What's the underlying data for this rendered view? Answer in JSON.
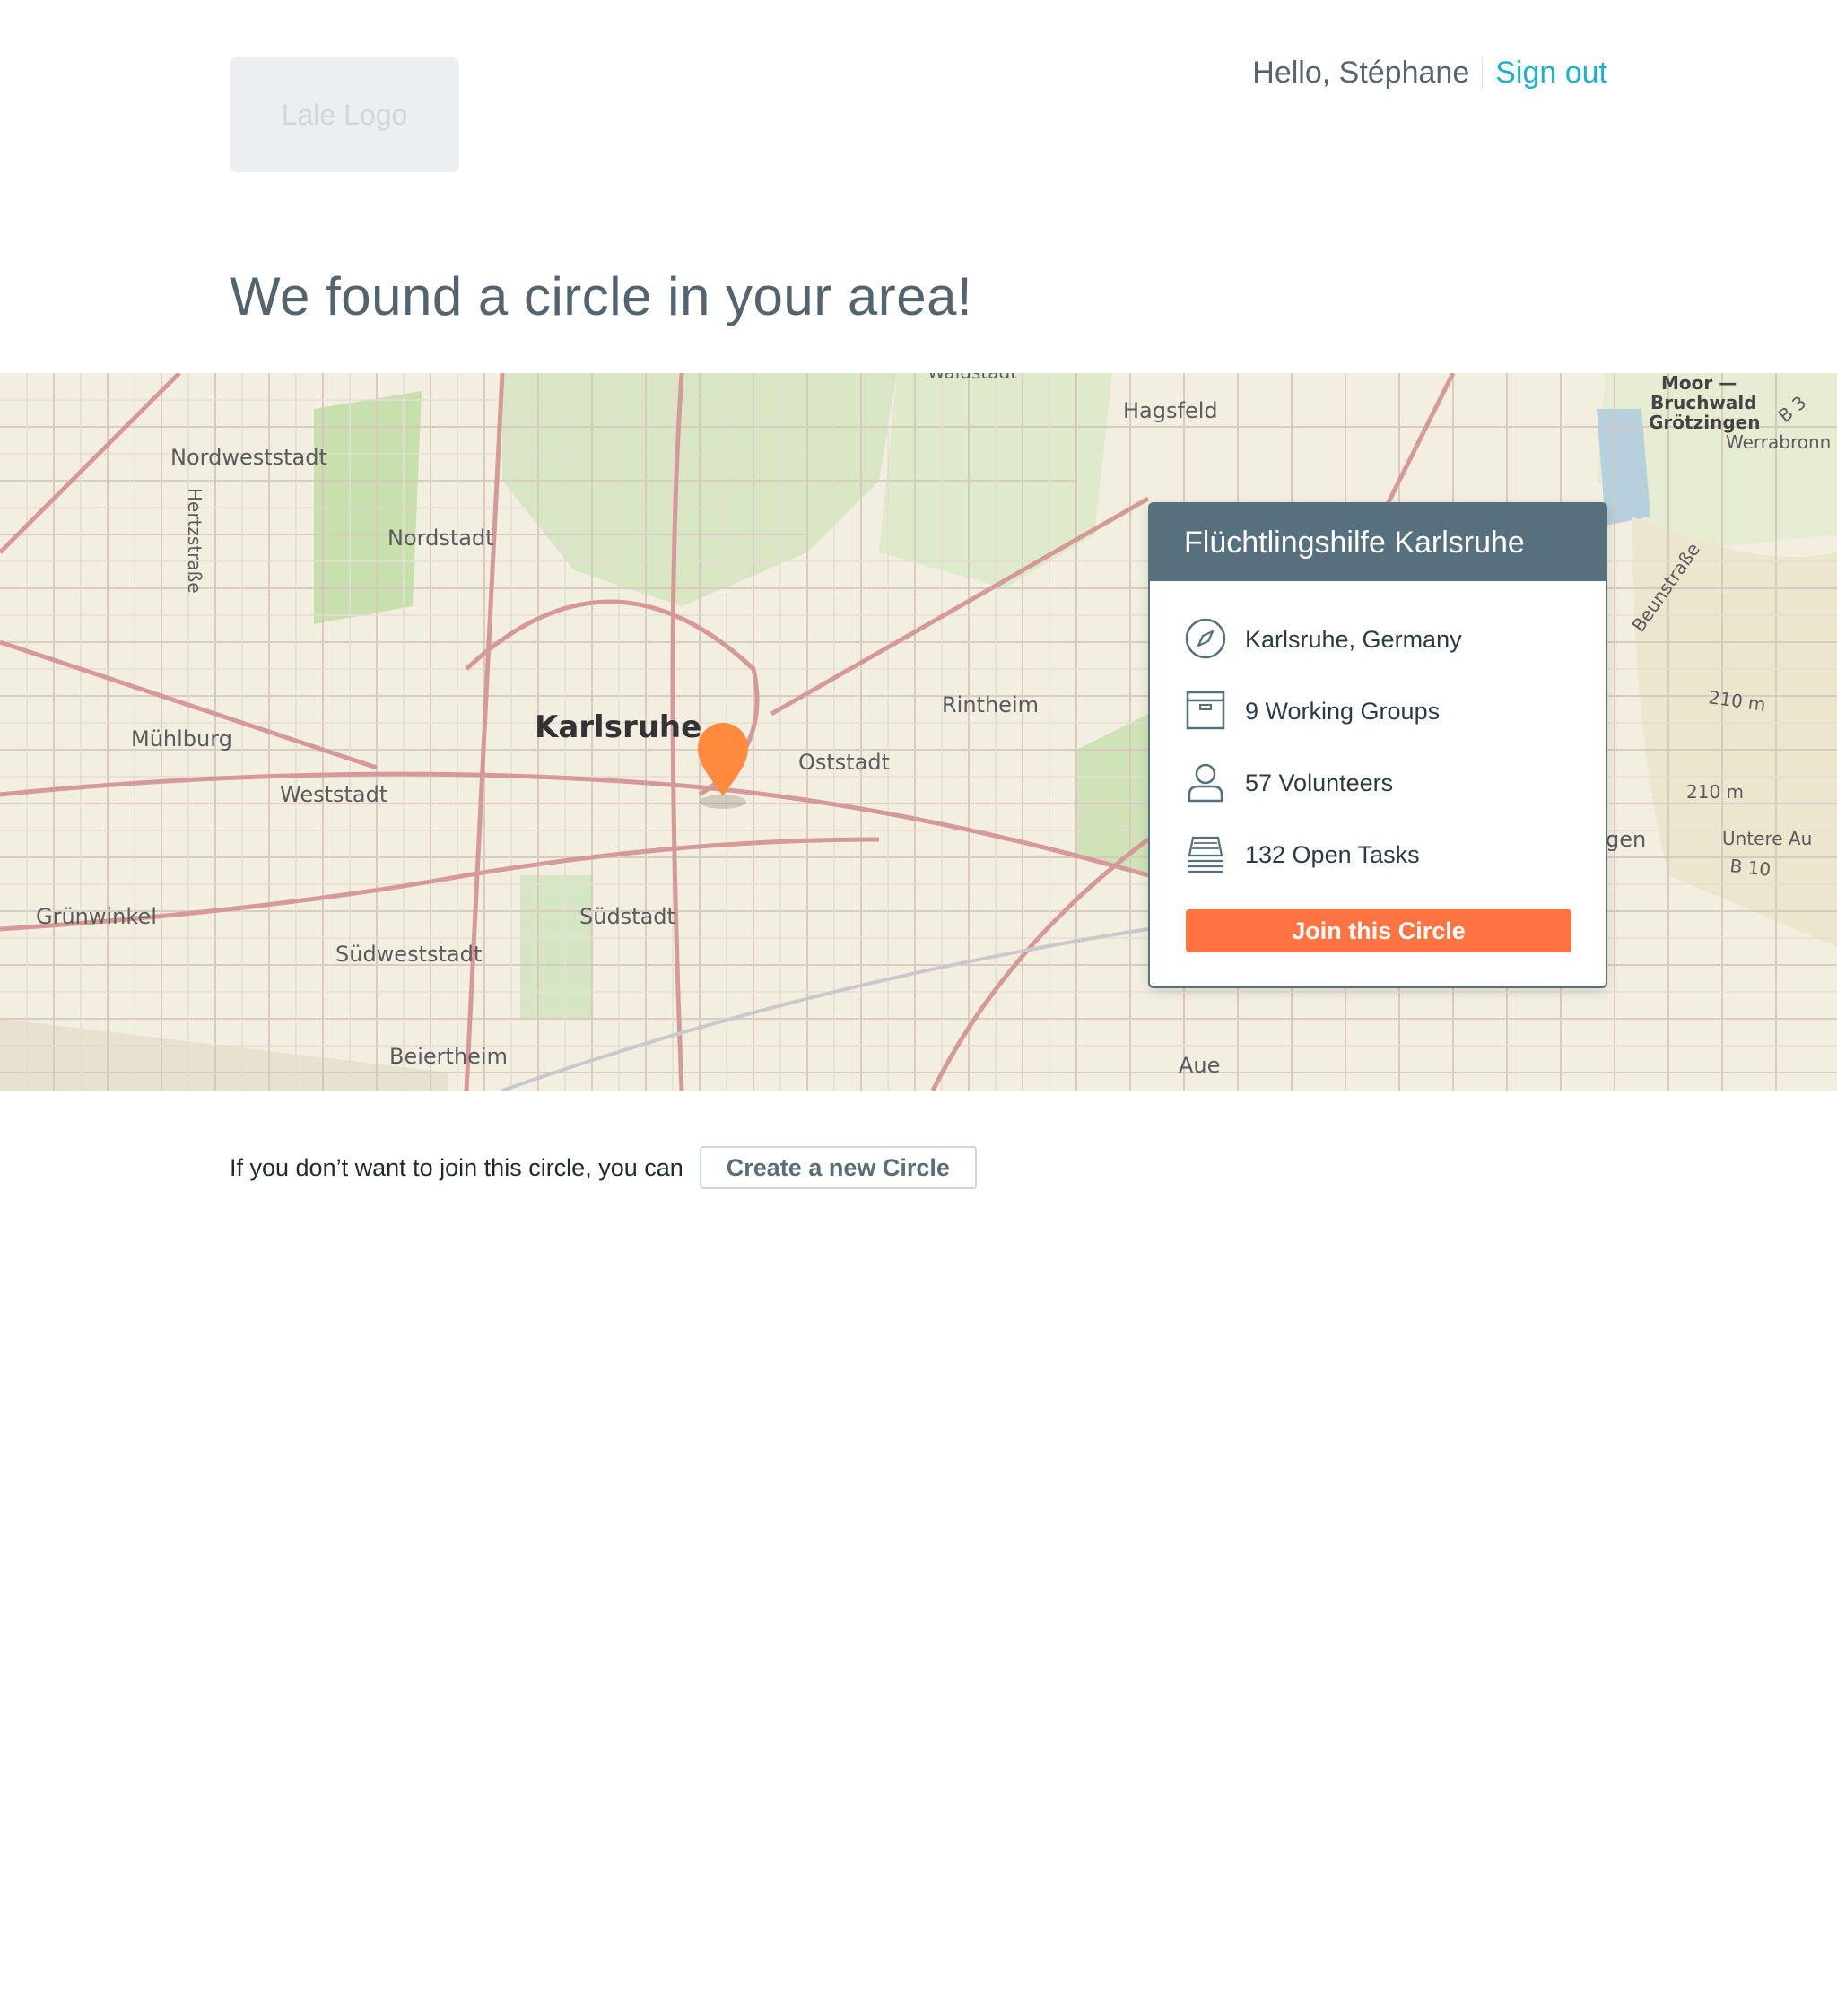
{
  "header": {
    "logo_text": "Lale Logo",
    "greeting": "Hello, Stéphane",
    "sign_out": "Sign out"
  },
  "headline": "We found a circle in your area!",
  "map": {
    "city_label": "Karlsruhe",
    "labels": {
      "nordweststadt": "Nordweststadt",
      "nordstadt": "Nordstadt",
      "hertzstrasse": "Hertzstraße",
      "muehlburg": "Mühlburg",
      "weststadt": "Weststadt",
      "gruenwinkel": "Grünwinkel",
      "suedweststadt": "Südweststadt",
      "beiertheim": "Beiertheim",
      "suedstadt": "Südstadt",
      "oststadt": "Oststadt",
      "rintheim": "Rintheim",
      "hagsfeld": "Hagsfeld",
      "aue": "Aue",
      "waldstadt": "Waldstadt",
      "moor": "Moor —",
      "bruchwald": "Bruchwald",
      "groetzingen": "Grötzingen",
      "werrabronn": "Werrabronn",
      "b3": "B 3",
      "beunstrasse": "Beunstraße",
      "elev1": "210 m",
      "elev2": "210 m",
      "untere_au": "Untere Au",
      "b10": "B 10",
      "gen": "gen"
    },
    "marker_icon": "map-pin-icon",
    "marker_color": "#ff8a3d"
  },
  "circle_card": {
    "title": "Flüchtlingshilfe Karlsruhe",
    "location": "Karlsruhe, Germany",
    "working_groups": "9 Working Groups",
    "volunteers": "57 Volunteers",
    "open_tasks": "132 Open Tasks",
    "join_button": "Join this Circle",
    "header_color": "#56707d",
    "button_color": "#ff7342"
  },
  "footer": {
    "prompt": "If you don’t want to join this circle, you can",
    "create_button": "Create a new Circle"
  }
}
